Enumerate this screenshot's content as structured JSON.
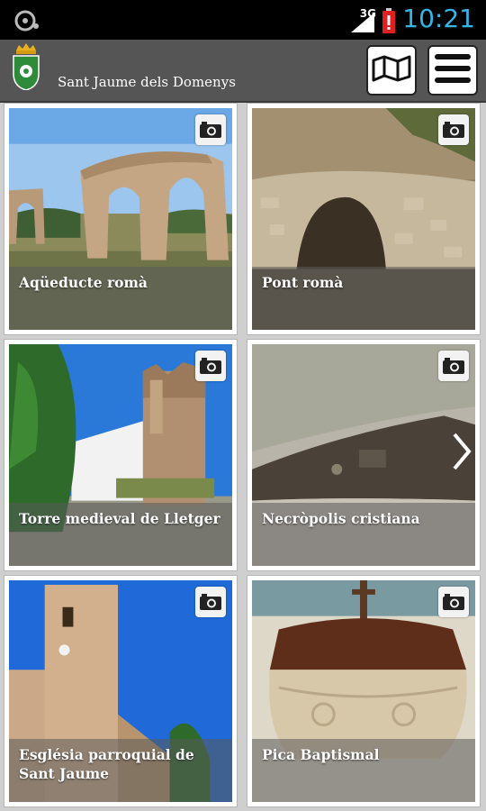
{
  "status_bar": {
    "network": "3G",
    "time": "10:21"
  },
  "header": {
    "title": "Sant Jaume dels Domenys",
    "map_button_icon": "folded-map-icon",
    "menu_button_icon": "hamburger-menu-icon"
  },
  "tiles": [
    {
      "label": "Aqüeducte romà",
      "icon": "camera-icon"
    },
    {
      "label": "Pont romà",
      "icon": "camera-icon"
    },
    {
      "label": "Torre medieval de Lletger",
      "icon": "camera-icon"
    },
    {
      "label": "Necròpolis cristiana",
      "icon": "camera-icon"
    },
    {
      "label": "Església parroquial de Sant Jaume",
      "icon": "camera-icon"
    },
    {
      "label": "Pica Baptismal",
      "icon": "camera-icon"
    }
  ],
  "colors": {
    "clock": "#33b5e5",
    "app_bar": "#555555",
    "battery_alert": "#e02020"
  }
}
